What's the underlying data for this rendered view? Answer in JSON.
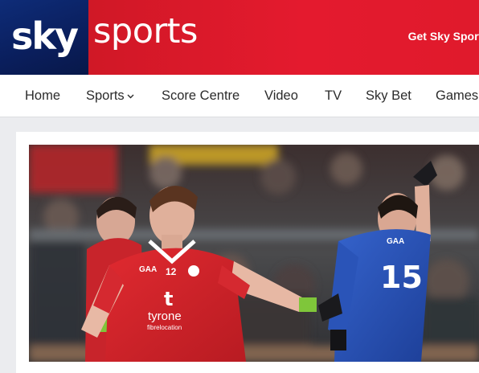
{
  "header": {
    "logo_sky": "sky",
    "logo_sports": "sports",
    "cta_label": "Get Sky Sports"
  },
  "nav": {
    "items": [
      {
        "label": "Home"
      },
      {
        "label": "Sports"
      },
      {
        "label": "Score Centre"
      },
      {
        "label": "Video"
      },
      {
        "label": "TV"
      },
      {
        "label": "Sky Bet"
      },
      {
        "label": "Games"
      }
    ]
  },
  "article": {
    "image": {
      "player_left": {
        "jersey_number": "12",
        "sponsor": "tyrone",
        "sponsor_sub": "fibrelocation",
        "crest": "GAA"
      },
      "player_right": {
        "jersey_number": "15",
        "crest": "GAA"
      }
    }
  },
  "colors": {
    "sky_blue": "#0a1e5c",
    "sports_red": "#e01a2c",
    "tyrone_red": "#d8232a",
    "monaghan_blue": "#2a54b8"
  }
}
